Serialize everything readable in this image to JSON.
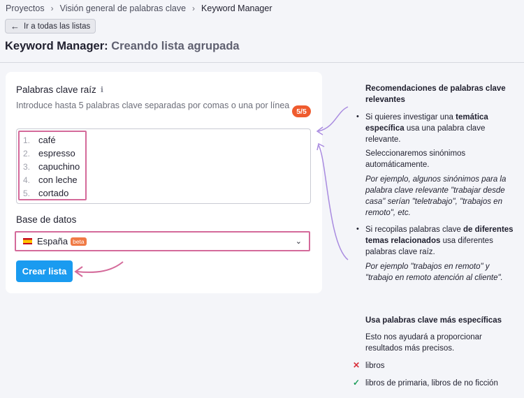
{
  "breadcrumb": [
    "Proyectos",
    "Visión general de palabras clave",
    "Keyword Manager"
  ],
  "back_button": "Ir a todas las listas",
  "title": {
    "main": "Keyword Manager:",
    "sub": "Creando lista agrupada"
  },
  "form": {
    "seed_label": "Palabras clave raíz",
    "hint": "Introduce hasta 5 palabras clave separadas por comas o una por línea",
    "counter": "5/5",
    "keywords": [
      {
        "n": "1.",
        "text": "café"
      },
      {
        "n": "2.",
        "text": "espresso"
      },
      {
        "n": "3.",
        "text": "capuchino"
      },
      {
        "n": "4.",
        "text": "con leche"
      },
      {
        "n": "5.",
        "text": "cortado"
      }
    ],
    "db_label": "Base de datos",
    "db_value": "España",
    "db_badge": "beta",
    "create_button": "Crear lista"
  },
  "tips": {
    "rec_title": "Recomendaciones de palabras clave relevantes",
    "b1_pre": "Si quieres investigar una ",
    "b1_bold": "temática específica",
    "b1_post": " usa una palabra clave relevante.",
    "b1_p2": "Seleccionaremos sinónimos automáticamente.",
    "b1_example": "Por ejemplo, algunos sinónimos para la palabra clave relevante \"trabajar desde casa\" serían \"teletrabajo\", \"trabajos en remoto\", etc.",
    "b2_pre": "Si recopilas palabras clave ",
    "b2_bold": "de diferentes temas relacionados",
    "b2_post": " usa diferentes palabras clave raíz.",
    "b2_example": "Por ejemplo \"trabajos en remoto\" y \"trabajo en remoto atención al cliente\".",
    "specific_title": "Usa palabras clave más específicas",
    "specific_desc": "Esto nos ayudará a proporcionar resultados más precisos.",
    "bad_example": "libros",
    "good_example": "libros de primaria, libros de no ficción"
  },
  "colors": {
    "accent": "#1a9bf0",
    "highlight": "#d46a9a",
    "annotation_arrow": "#a98be0",
    "counter": "#ef5b2e"
  }
}
